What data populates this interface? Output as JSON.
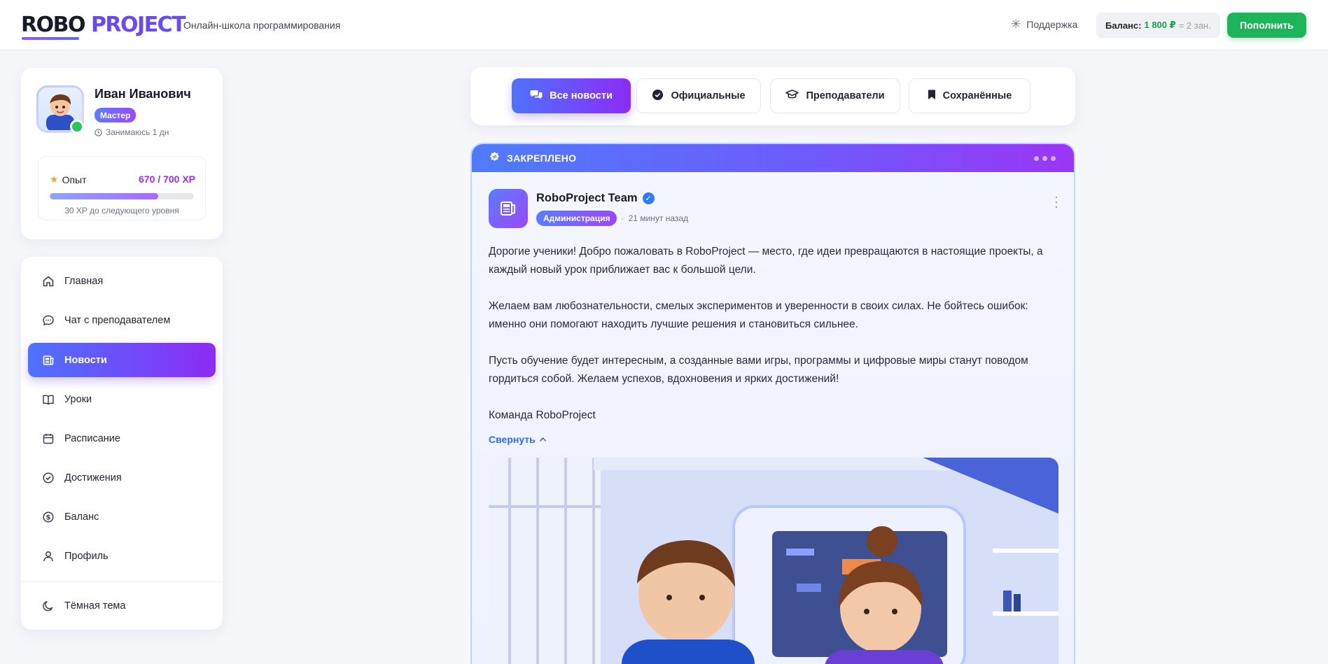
{
  "header": {
    "logo_part1": "ROBO",
    "logo_part2": "PROJECT",
    "tagline": "Онлайн-школа программирования",
    "support_label": "Поддержка",
    "balance_label": "Баланс:",
    "balance_amount": "1 800 ₽",
    "balance_extra": "= 2 зан.",
    "topup_label": "Пополнить"
  },
  "profile": {
    "name": "Иван Иванович",
    "rank": "Мастер",
    "studying": "Занимаюсь 1 дн",
    "xp_label": "Опыт",
    "xp_value": "670 / 700 XP",
    "xp_progress": 0.75,
    "xp_next": "30 XP до следующего уровня"
  },
  "nav": {
    "items": [
      {
        "label": "Главная",
        "icon": "home-icon"
      },
      {
        "label": "Чат с преподавателем",
        "icon": "chat-icon"
      },
      {
        "label": "Новости",
        "icon": "newspaper-icon",
        "active": true
      },
      {
        "label": "Уроки",
        "icon": "book-icon"
      },
      {
        "label": "Расписание",
        "icon": "calendar-icon"
      },
      {
        "label": "Достижения",
        "icon": "check-circle-icon"
      },
      {
        "label": "Баланс",
        "icon": "dollar-icon"
      },
      {
        "label": "Профиль",
        "icon": "user-icon"
      }
    ],
    "theme_toggle": "Тёмная тема"
  },
  "tabs": [
    {
      "label": "Все новости",
      "active": true
    },
    {
      "label": "Официальные"
    },
    {
      "label": "Преподаватели"
    },
    {
      "label": "Сохранённые"
    }
  ],
  "post": {
    "pinned_label": "ЗАКРЕПЛЕНО",
    "author": "RoboProject Team",
    "author_badge": "Администрация",
    "time": "21 минут назад",
    "paragraphs": [
      "Дорогие ученики! Добро пожаловать в RoboProject — место, где идеи превращаются в настоящие проекты, а каждый новый урок приближает вас к большой цели.",
      "Желаем вам любознательности, смелых экспериментов и уверенности в своих силах. Не бойтесь ошибок: именно они помогают находить лучшие решения и становиться сильнее.",
      "Пусть обучение будет интересным, а созданные вами игры, программы и цифровые миры станут поводом гордиться собой. Желаем успехов, вдохновения и ярких достижений!",
      "Команда RoboProject"
    ],
    "collapse_label": "Свернуть"
  },
  "colors": {
    "accent_start": "#4e72ff",
    "accent_end": "#8c2cf5",
    "success": "#1db45a",
    "xp_text": "#9b2cf5"
  }
}
